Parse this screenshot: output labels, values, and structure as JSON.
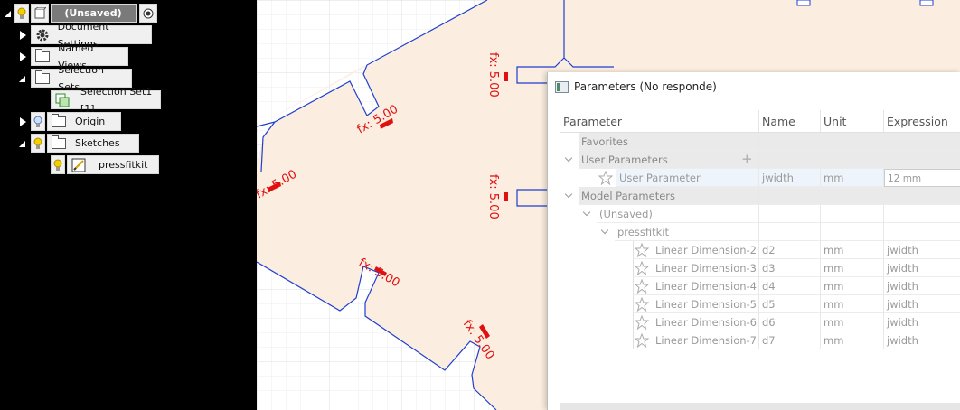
{
  "browser": {
    "root": "(Unsaved)",
    "items": [
      {
        "label": "Document Settings"
      },
      {
        "label": "Named Views"
      },
      {
        "label": "Selection Sets"
      },
      {
        "label": "Selection Set1 [1]"
      },
      {
        "label": "Origin"
      },
      {
        "label": "Sketches"
      },
      {
        "label": "pressfitkit"
      }
    ]
  },
  "canvas": {
    "dimension_label": "fx: 5.00"
  },
  "dialog": {
    "title": "Parameters (No responde)",
    "columns": [
      "Parameter",
      "Name",
      "Unit",
      "Expression"
    ],
    "favorites": "Favorites",
    "user_group": "User Parameters",
    "user_param": {
      "label": "User Parameter",
      "name": "jwidth",
      "unit": "mm",
      "expression": "12 mm"
    },
    "model_group": "Model Parameters",
    "unsaved": "(Unsaved)",
    "component": "pressfitkit",
    "rows": [
      {
        "label": "Linear Dimension-2",
        "name": "d2",
        "unit": "mm",
        "expression": "jwidth"
      },
      {
        "label": "Linear Dimension-3",
        "name": "d3",
        "unit": "mm",
        "expression": "jwidth"
      },
      {
        "label": "Linear Dimension-4",
        "name": "d4",
        "unit": "mm",
        "expression": "jwidth"
      },
      {
        "label": "Linear Dimension-5",
        "name": "d5",
        "unit": "mm",
        "expression": "jwidth"
      },
      {
        "label": "Linear Dimension-6",
        "name": "d6",
        "unit": "mm",
        "expression": "jwidth"
      },
      {
        "label": "Linear Dimension-7",
        "name": "d7",
        "unit": "mm",
        "expression": "jwidth"
      }
    ]
  },
  "colors": {
    "sketch_fill": "#fbeee0",
    "sketch_line": "#1f3fd0",
    "dimension": "#e01010",
    "grid": "#e6e6e6"
  }
}
